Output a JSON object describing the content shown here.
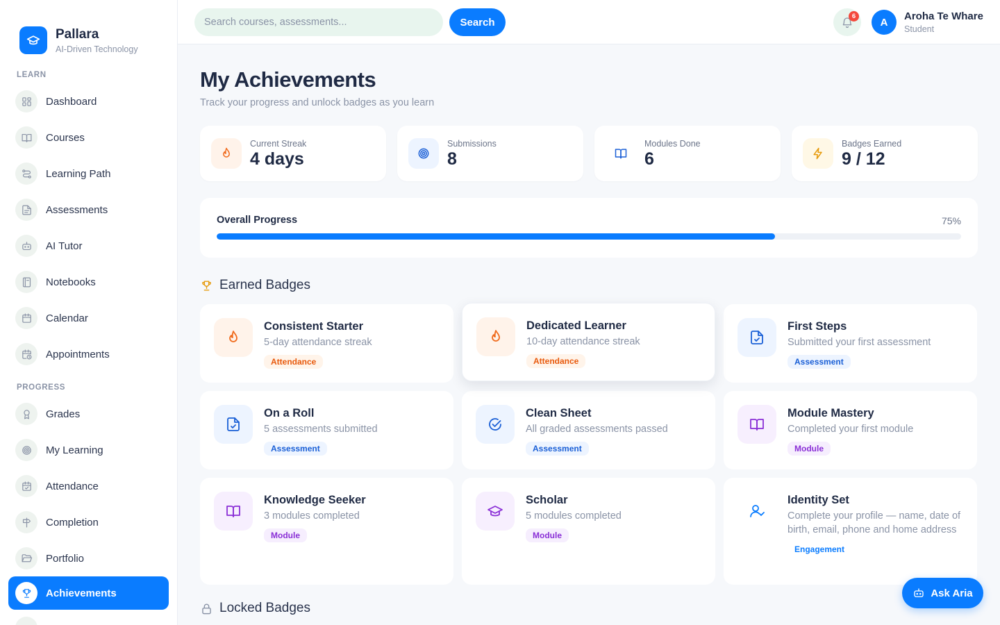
{
  "brand": {
    "name": "Pallara",
    "tagline": "AI-Driven Technology"
  },
  "sidebar": {
    "learn_label": "LEARN",
    "learn_items": [
      {
        "label": "Dashboard",
        "icon": "grid-icon"
      },
      {
        "label": "Courses",
        "icon": "book-open-icon"
      },
      {
        "label": "Learning Path",
        "icon": "route-icon"
      },
      {
        "label": "Assessments",
        "icon": "file-text-icon"
      },
      {
        "label": "AI Tutor",
        "icon": "bot-icon"
      },
      {
        "label": "Notebooks",
        "icon": "notebook-icon"
      },
      {
        "label": "Calendar",
        "icon": "calendar-icon"
      },
      {
        "label": "Appointments",
        "icon": "calendar-clock-icon"
      }
    ],
    "progress_label": "PROGRESS",
    "progress_items": [
      {
        "label": "Grades",
        "icon": "award-icon"
      },
      {
        "label": "My Learning",
        "icon": "target-icon"
      },
      {
        "label": "Attendance",
        "icon": "calendar-check-icon"
      },
      {
        "label": "Completion",
        "icon": "signpost-icon"
      },
      {
        "label": "Portfolio",
        "icon": "folder-open-icon"
      },
      {
        "label": "Achievements",
        "icon": "trophy-icon",
        "active": true
      }
    ]
  },
  "topbar": {
    "search_placeholder": "Search courses, assessments...",
    "search_button": "Search",
    "notification_count": "6",
    "user_initial": "A",
    "user_name": "Aroha Te Whare",
    "user_role": "Student"
  },
  "page": {
    "title": "My Achievements",
    "subtitle": "Track your progress and unlock badges as you learn"
  },
  "stats": [
    {
      "label": "Current Streak",
      "value": "4 days",
      "icon": "flame-icon",
      "color": "#f06a1c"
    },
    {
      "label": "Submissions",
      "value": "8",
      "icon": "target-icon",
      "color": "#1a5fd6"
    },
    {
      "label": "Modules Done",
      "value": "6",
      "icon": "book-open-icon",
      "color": "#1a5fd6"
    },
    {
      "label": "Badges Earned",
      "value": "9 / 12",
      "icon": "zap-icon",
      "color": "#e69a0b"
    }
  ],
  "progress": {
    "label": "Overall Progress",
    "percent_text": "75%",
    "value": 75
  },
  "earned": {
    "heading": "Earned Badges",
    "badges": [
      {
        "title": "Consistent Starter",
        "desc": "5-day attendance streak",
        "tag": "Attendance",
        "icon": "flame-icon"
      },
      {
        "title": "Dedicated Learner",
        "desc": "10-day attendance streak",
        "tag": "Attendance",
        "icon": "flame-icon"
      },
      {
        "title": "First Steps",
        "desc": "Submitted your first assessment",
        "tag": "Assessment",
        "icon": "file-check-icon"
      },
      {
        "title": "On a Roll",
        "desc": "5 assessments submitted",
        "tag": "Assessment",
        "icon": "file-check-icon"
      },
      {
        "title": "Clean Sheet",
        "desc": "All graded assessments passed",
        "tag": "Assessment",
        "icon": "circle-check-icon"
      },
      {
        "title": "Module Mastery",
        "desc": "Completed your first module",
        "tag": "Module",
        "icon": "book-open-icon"
      },
      {
        "title": "Knowledge Seeker",
        "desc": "3 modules completed",
        "tag": "Module",
        "icon": "book-open-icon"
      },
      {
        "title": "Scholar",
        "desc": "5 modules completed",
        "tag": "Module",
        "icon": "graduation-cap-icon"
      },
      {
        "title": "Identity Set",
        "desc": "Complete your profile — name, date of birth, email, phone and home address",
        "tag": "Engagement",
        "icon": "user-check-icon"
      }
    ]
  },
  "locked": {
    "heading": "Locked Badges"
  },
  "ask": {
    "label": "Ask Aria"
  },
  "colors": {
    "accent": "#0a7cff",
    "attendance": "#e8590c",
    "assessment": "#1a5fd6",
    "module": "#8a2fd6"
  }
}
